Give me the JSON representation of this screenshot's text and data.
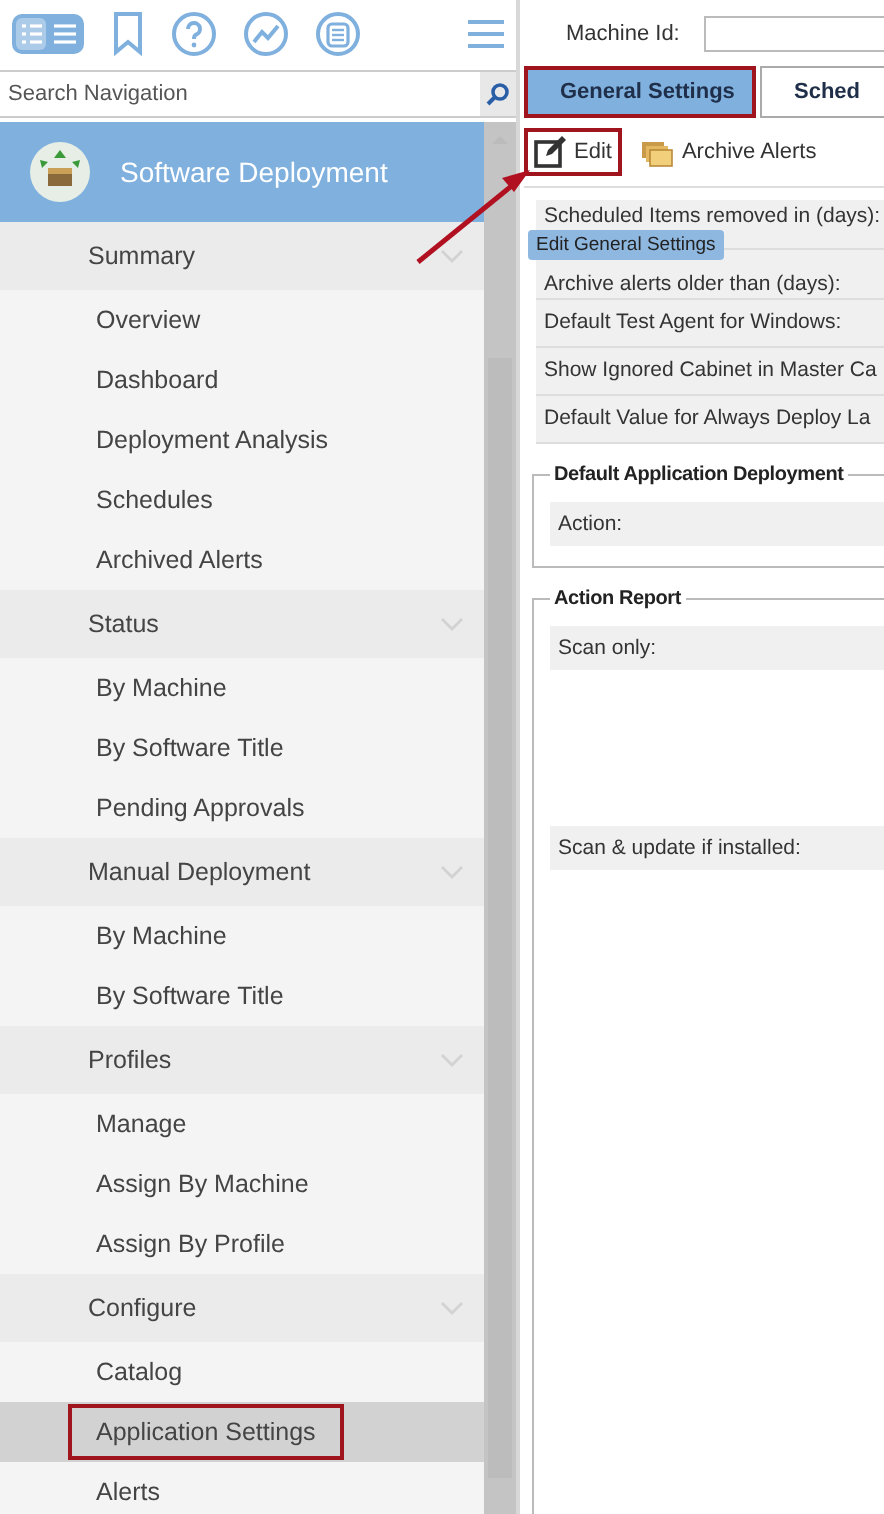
{
  "search": {
    "placeholder": "Search Navigation"
  },
  "nav_header": {
    "title": "Software Deployment"
  },
  "nav": [
    {
      "label": "Summary",
      "items": [
        {
          "label": "Overview",
          "selected": false,
          "annotated": false
        },
        {
          "label": "Dashboard",
          "selected": false,
          "annotated": false
        },
        {
          "label": "Deployment Analysis",
          "selected": false,
          "annotated": false
        },
        {
          "label": "Schedules",
          "selected": false,
          "annotated": false
        },
        {
          "label": "Archived Alerts",
          "selected": false,
          "annotated": false
        }
      ]
    },
    {
      "label": "Status",
      "items": [
        {
          "label": "By Machine",
          "selected": false,
          "annotated": false
        },
        {
          "label": "By Software Title",
          "selected": false,
          "annotated": false
        },
        {
          "label": "Pending Approvals",
          "selected": false,
          "annotated": false
        }
      ]
    },
    {
      "label": "Manual Deployment",
      "items": [
        {
          "label": "By Machine",
          "selected": false,
          "annotated": false
        },
        {
          "label": "By Software Title",
          "selected": false,
          "annotated": false
        }
      ]
    },
    {
      "label": "Profiles",
      "items": [
        {
          "label": "Manage",
          "selected": false,
          "annotated": false
        },
        {
          "label": "Assign By Machine",
          "selected": false,
          "annotated": false
        },
        {
          "label": "Assign By Profile",
          "selected": false,
          "annotated": false
        }
      ]
    },
    {
      "label": "Configure",
      "items": [
        {
          "label": "Catalog",
          "selected": false,
          "annotated": false
        },
        {
          "label": "Application Settings",
          "selected": true,
          "annotated": true
        },
        {
          "label": "Alerts",
          "selected": false,
          "annotated": false
        }
      ]
    }
  ],
  "machine_id": {
    "label": "Machine Id:"
  },
  "tabs": [
    {
      "label": "General Settings",
      "selected": true,
      "annotated": true
    },
    {
      "label": "Sched",
      "selected": false,
      "annotated": false
    }
  ],
  "toolbar": [
    {
      "label": "Edit",
      "kind": "edit",
      "annotated": true
    },
    {
      "label": "Archive Alerts",
      "kind": "archive",
      "annotated": false
    }
  ],
  "tooltip": "Edit General Settings",
  "settings": [
    "Scheduled Items removed in (days):",
    "Archive alerts older than (days):",
    "Default Test Agent for Windows:",
    "Show Ignored Cabinet in Master Ca",
    "Default Value for Always Deploy La"
  ],
  "groups": [
    {
      "title": "Default Application Deployment",
      "rows": [
        "Action:"
      ]
    },
    {
      "title": "Action Report",
      "rows": [
        "Scan only:",
        "Scan & update if installed:"
      ]
    }
  ]
}
